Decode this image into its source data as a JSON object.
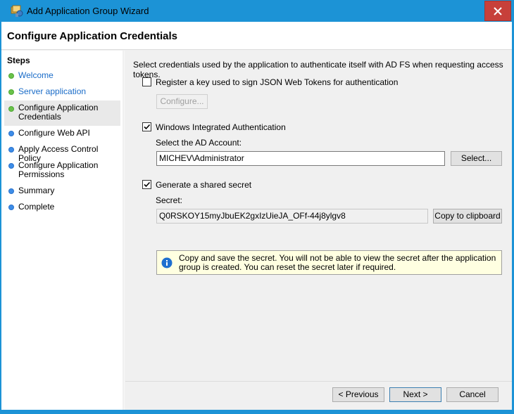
{
  "window": {
    "title": "Add Application Group Wizard",
    "accent": "#1c93d6",
    "close_color": "#c7403a"
  },
  "header": {
    "title": "Configure Application Credentials"
  },
  "sidebar": {
    "title": "Steps",
    "items": [
      {
        "label": "Welcome",
        "state": "done"
      },
      {
        "label": "Server application",
        "state": "done"
      },
      {
        "label": "Configure Application Credentials",
        "state": "current"
      },
      {
        "label": "Configure Web API",
        "state": "pending"
      },
      {
        "label": "Apply Access Control Policy",
        "state": "pending"
      },
      {
        "label": "Configure Application Permissions",
        "state": "pending"
      },
      {
        "label": "Summary",
        "state": "pending"
      },
      {
        "label": "Complete",
        "state": "pending"
      }
    ]
  },
  "main": {
    "intro": "Select credentials used by the application to authenticate itself with AD FS when requesting access tokens.",
    "jwt": {
      "label": "Register a key used to sign JSON Web Tokens for authentication",
      "checked": false,
      "configure_label": "Configure..."
    },
    "wia": {
      "label": "Windows Integrated Authentication",
      "checked": true,
      "account_label": "Select the AD Account:",
      "account_value": "MICHEV\\Administrator",
      "select_label": "Select..."
    },
    "secret": {
      "label": "Generate a shared secret",
      "checked": true,
      "secret_label": "Secret:",
      "secret_value": "Q0RSKOY15myJbuEK2gxIzUieJA_OFf-44j8ylgv8",
      "copy_label": "Copy to clipboard",
      "info": "Copy and save the secret.  You will not be able to view the secret after the application group is created.  You can reset the secret later if required."
    }
  },
  "footer": {
    "previous_label": "< Previous",
    "next_label": "Next >",
    "cancel_label": "Cancel"
  }
}
